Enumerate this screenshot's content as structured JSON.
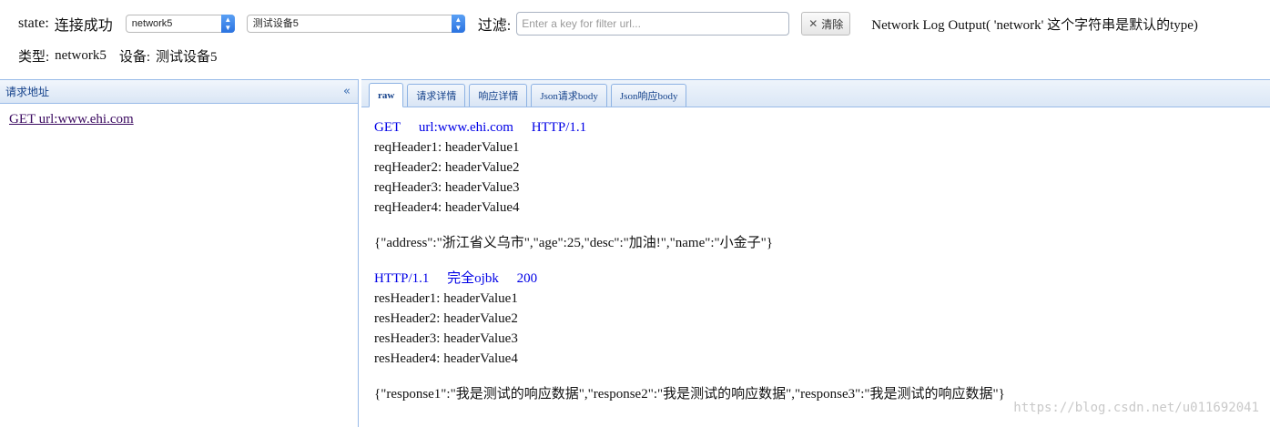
{
  "toolbar": {
    "state_label": "state:",
    "state_value": "连接成功",
    "type_select": "network5",
    "device_select": "测试设备5",
    "filter_label": "过滤:",
    "filter_placeholder": "Enter a key for filter url...",
    "clear_button": "清除",
    "output_note": "Network Log Output( 'network' 这个字符串是默认的type)",
    "type_label": "类型:",
    "type_value": "network5",
    "device_label": "设备:",
    "device_value": "测试设备5"
  },
  "left_panel": {
    "title": "请求地址",
    "items": [
      "GET url:www.ehi.com"
    ]
  },
  "tabs": [
    "raw",
    "请求详情",
    "响应详情",
    "Json请求body",
    "Json响应body"
  ],
  "active_tab": "raw",
  "request": {
    "method": "GET",
    "url": "url:www.ehi.com",
    "protocol": "HTTP/1.1",
    "headers": [
      "reqHeader1: headerValue1",
      "reqHeader2: headerValue2",
      "reqHeader3: headerValue3",
      "reqHeader4: headerValue4"
    ],
    "body": "{\"address\":\"浙江省义乌市\",\"age\":25,\"desc\":\"加油!\",\"name\":\"小金子\"}"
  },
  "response": {
    "protocol": "HTTP/1.1",
    "status_text": "完全ojbk",
    "status_code": "200",
    "headers": [
      "resHeader1: headerValue1",
      "resHeader2: headerValue2",
      "resHeader3: headerValue3",
      "resHeader4: headerValue4"
    ],
    "body": "{\"response1\":\"我是测试的响应数据\",\"response2\":\"我是测试的响应数据\",\"response3\":\"我是测试的响应数据\"}"
  },
  "watermark": "https://blog.csdn.net/u011692041"
}
